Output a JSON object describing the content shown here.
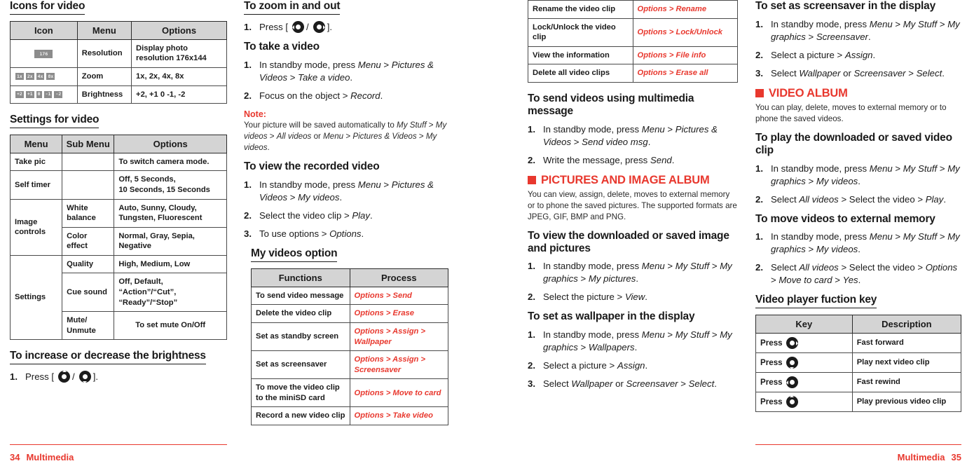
{
  "colors": {
    "accent_red": "#e8382e",
    "header_fill": "#d4d4d4",
    "text": "#1a1a1a"
  },
  "footer": {
    "left_page": "34",
    "left_label": "Multimedia",
    "right_label": "Multimedia",
    "right_page": "35"
  },
  "col1": {
    "icons_heading": "Icons for video",
    "icons_table": {
      "headers": [
        "Icon",
        "Menu",
        "Options"
      ],
      "rows": [
        {
          "icon_glyphs": [
            "176"
          ],
          "menu": "Resolution",
          "options": "Display photo resolution 176x144"
        },
        {
          "icon_glyphs": [
            "1x",
            "2x",
            "4x",
            "8x"
          ],
          "menu": "Zoom",
          "options": "1x, 2x, 4x, 8x"
        },
        {
          "icon_glyphs": [
            "+2",
            "+1",
            "0",
            "-1",
            "-2"
          ],
          "menu": "Brightness",
          "options": "+2, +1  0 -1, -2"
        }
      ]
    },
    "settings_heading": "Settings for video",
    "settings_table": {
      "headers": [
        "Menu",
        "Sub Menu",
        "Options"
      ],
      "rows": [
        {
          "menu": "Take pic",
          "sub": "",
          "options": "To switch camera mode.",
          "rowspan": 1
        },
        {
          "menu": "Self timer",
          "sub": "",
          "options": "Off, 5 Seconds,\n10 Seconds, 15 Seconds",
          "rowspan": 1
        },
        {
          "menu": "Image controls",
          "sub": "White balance",
          "options": "Auto, Sunny, Cloudy, Tungsten, Fluorescent",
          "rowspan": 2
        },
        {
          "menu": "",
          "sub": "Color effect",
          "options": "Normal, Gray, Sepia, Negative"
        },
        {
          "menu": "Settings",
          "sub": "Quality",
          "options": "High, Medium, Low",
          "rowspan": 3
        },
        {
          "menu": "",
          "sub": "Cue sound",
          "options": "Off, Default, “Action”/“Cut”,  “Ready”/“Stop”"
        },
        {
          "menu": "",
          "sub": "Mute/ Unmute",
          "options": "To set mute On/Off"
        }
      ]
    },
    "brightness_heading": "To increase or decrease the brightness",
    "brightness_step": {
      "prefix": "Press [",
      "sep": "/",
      "suffix": "]."
    }
  },
  "col2": {
    "zoom_heading": "To zoom in and out",
    "zoom_step": {
      "prefix": "Press [",
      "sep": "/",
      "suffix": "]."
    },
    "take_video_heading": "To take a video",
    "take_video_steps": [
      "In standby mode, press <i>Menu</i> > <i>Pictures &amp; Videos</i> > <i>Take a video</i>.",
      "Focus on the object > <i>Record</i>."
    ],
    "note_label": "Note:",
    "note_body": "Your picture will be saved automatically to <i>My Stuff</i> > <i>My videos</i> > <i>All videos</i> or <i>Menu</i> > <i>Pictures &amp; Videos</i> > <i>My videos</i>.",
    "view_recorded_heading": "To view the recorded video",
    "view_recorded_steps": [
      "In standby mode, press <i>Menu</i> > <i>Pictures &amp; Videos</i> > <i>My videos</i>.",
      "Select the video clip > <i>Play</i>.",
      "To use options > <i>Options</i>."
    ],
    "my_videos_option_heading": "My videos option",
    "my_videos_table": {
      "headers": [
        "Functions",
        "Process"
      ],
      "rows": [
        {
          "function": "To send video message",
          "process": "Options > Send"
        },
        {
          "function": "Delete the video clip",
          "process": "Options > Erase"
        },
        {
          "function": "Set as standby screen",
          "process": "Options > Assign > Wallpaper"
        },
        {
          "function": "Set as screensaver",
          "process": "Options > Assign > Screensaver"
        },
        {
          "function": "To move the video clip to the miniSD card",
          "process": "Options > Move to card"
        },
        {
          "function": "Record a new video clip",
          "process": "Options > Take video"
        }
      ]
    }
  },
  "col3": {
    "continued_table": {
      "rows": [
        {
          "function": "Rename the video clip",
          "process": "Options > Rename"
        },
        {
          "function": "Lock/Unlock the video clip",
          "process": "Options > Lock/Unlock"
        },
        {
          "function": "View the information",
          "process": "Options > File info"
        },
        {
          "function": "Delete all video clips",
          "process": "Options > Erase all"
        }
      ]
    },
    "send_videos_heading": "To send videos using multimedia message",
    "send_videos_steps": [
      "In standby mode, press <i>Menu</i> > <i>Pictures &amp; Videos</i> > <i>Send video msg</i>.",
      "Write the message, press <i>Send</i>."
    ],
    "pictures_album_heading": "PICTURES AND IMAGE ALBUM",
    "pictures_album_body": "You can view, assign, delete, moves to external memory or to phone the saved pictures. The supported formats are JPEG, GIF, BMP and PNG.",
    "view_images_heading": "To view the downloaded or saved image and pictures",
    "view_images_steps": [
      "In standby mode, press <i>Menu</i> > <i>My Stuff</i> > <i>My graphics</i> > <i>My pictures</i>.",
      "Select the picture > <i>View</i>."
    ],
    "wallpaper_heading": "To set as wallpaper in the display",
    "wallpaper_steps": [
      "In standby mode, press <i>Menu</i> > <i>My Stuff</i> > <i>My graphics</i> > <i>Wallpapers</i>.",
      "Select a picture > <i>Assign</i>.",
      "Select <i>Wallpaper</i> or <i>Screensaver</i> > <i>Select</i>."
    ]
  },
  "col4": {
    "screensaver_heading": "To set as screensaver in the display",
    "screensaver_steps": [
      "In standby mode, press <i>Menu</i> > <i>My Stuff</i> > <i>My graphics</i> > <i>Screensaver</i>.",
      "Select a picture > <i>Assign</i>.",
      "Select <i>Wallpaper</i> or <i>Screensaver</i> > <i>Select</i>."
    ],
    "video_album_heading": "VIDEO ALBUM",
    "video_album_body": "You can play, delete, moves to external memory or to phone the saved videos.",
    "play_video_heading": "To play the downloaded or saved video clip",
    "play_video_steps": [
      "In standby mode, press <i>Menu</i> > <i>My Stuff</i> > <i>My graphics</i> > <i>My videos</i>.",
      "Select <i>All videos</i> > Select the video > <i>Play</i>."
    ],
    "move_videos_heading": "To move videos to external memory",
    "move_videos_steps": [
      "In standby mode, press <i>Menu</i> > <i>My Stuff</i> > <i>My graphics</i> > <i>My videos</i>.",
      "Select <i>All videos</i> > Select the video > <i>Options</i> > <i>Move to card</i> > <i>Yes</i>."
    ],
    "function_key_heading": "Video player fuction key",
    "key_table": {
      "headers": [
        "Key",
        "Description"
      ],
      "rows": [
        {
          "press": "Press",
          "direction": "right",
          "description": "Fast forward"
        },
        {
          "press": "Press",
          "direction": "down",
          "description": "Play next video clip"
        },
        {
          "press": "Press",
          "direction": "left",
          "description": "Fast rewind"
        },
        {
          "press": "Press",
          "direction": "up",
          "description": "Play previous video clip"
        }
      ]
    }
  }
}
